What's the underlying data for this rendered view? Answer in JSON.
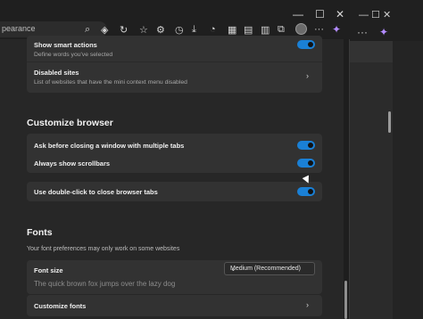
{
  "browser": {
    "address_text": "pearance",
    "window_controls": {
      "minimize": "—",
      "maximize": "☐",
      "close": "✕"
    },
    "background_window": {
      "controls": "—  ☐  ✕",
      "menu": "···"
    }
  },
  "smart_actions": {
    "title": "Show smart actions",
    "desc": "Define words you've selected",
    "enabled": true
  },
  "disabled_sites": {
    "title": "Disabled sites",
    "desc": "List of websites that have the mini context menu disabled"
  },
  "customize_browser": {
    "heading": "Customize browser",
    "items": [
      {
        "label": "Ask before closing a window with multiple tabs",
        "enabled": true
      },
      {
        "label": "Always show scrollbars",
        "enabled": true
      }
    ],
    "double_click": {
      "label": "Use double-click to close browser tabs",
      "enabled": true
    }
  },
  "fonts": {
    "heading": "Fonts",
    "subtitle": "Your font preferences may only work on some websites",
    "font_size_label": "Font size",
    "font_size_value": "Medium (Recommended)",
    "preview_text": "The quick brown fox jumps over the lazy dog",
    "customize_label": "Customize fonts"
  },
  "colors": {
    "toggle_on": "#1a80d6",
    "accent": "#b48cff"
  }
}
